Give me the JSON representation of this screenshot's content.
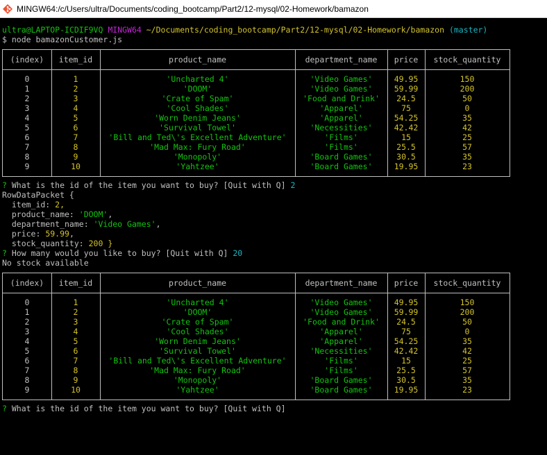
{
  "window": {
    "title": "MINGW64:/c/Users/ultra/Documents/coding_bootcamp/Part2/12-mysql/02-Homework/bamazon",
    "icon": "git-bash-icon"
  },
  "prompt": {
    "user_host": "ultra@LAPTOP-ICDIF9VQ",
    "shell": "MINGW64",
    "path": "~/Documents/coding_bootcamp/Part2/12-mysql/02-Homework/bamazon",
    "branch": "(master)",
    "command": "$ node bamazonCustomer.js"
  },
  "table": {
    "headers": [
      "(index)",
      "item_id",
      "product_name",
      "department_name",
      "price",
      "stock_quantity"
    ],
    "rows": [
      [
        "0",
        "1",
        "'Uncharted 4'",
        "'Video Games'",
        "49.95",
        "150"
      ],
      [
        "1",
        "2",
        "'DOOM'",
        "'Video Games'",
        "59.99",
        "200"
      ],
      [
        "2",
        "3",
        "'Crate of Spam'",
        "'Food and Drink'",
        "24.5",
        "50"
      ],
      [
        "3",
        "4",
        "'Cool Shades'",
        "'Apparel'",
        "75",
        "0"
      ],
      [
        "4",
        "5",
        "'Worn Denim Jeans'",
        "'Apparel'",
        "54.25",
        "35"
      ],
      [
        "5",
        "6",
        "'Survival Towel'",
        "'Necessities'",
        "42.42",
        "42"
      ],
      [
        "6",
        "7",
        "'Bill and Ted\\'s Excellent Adventure'",
        "'Films'",
        "15",
        "25"
      ],
      [
        "7",
        "8",
        "'Mad Max: Fury Road'",
        "'Films'",
        "25.5",
        "57"
      ],
      [
        "8",
        "9",
        "'Monopoly'",
        "'Board Games'",
        "30.5",
        "35"
      ],
      [
        "9",
        "10",
        "'Yahtzee'",
        "'Board Games'",
        "19.95",
        "23"
      ]
    ]
  },
  "session": {
    "q_mark": "?",
    "ask_id": "What is the id of the item you want to buy? [Quit with Q]",
    "answer_id": "2",
    "row_open": "RowDataPacket {",
    "item_id_key": "  item_id: ",
    "item_id_val": "2,",
    "product_name_key": "  product_name: ",
    "product_name_val": "'DOOM'",
    "department_name_key": "  department_name: ",
    "department_name_val": "'Video Games'",
    "price_key": "  price: ",
    "price_val": "59.99",
    "stock_key": "  stock_quantity: ",
    "stock_val": "200 }",
    "comma": ",",
    "ask_qty": "How many would you like to buy? [Quit with Q]",
    "answer_qty": "20",
    "no_stock": "No stock available",
    "ask_id_again": "What is the id of the item you want to buy? [Quit with Q]"
  },
  "colors": {
    "background": "#000000",
    "text": "#c0c0c0",
    "string": "#13c40f",
    "number": "#d4c32a",
    "shell": "#c026d3",
    "branch": "#1ab6c3"
  }
}
